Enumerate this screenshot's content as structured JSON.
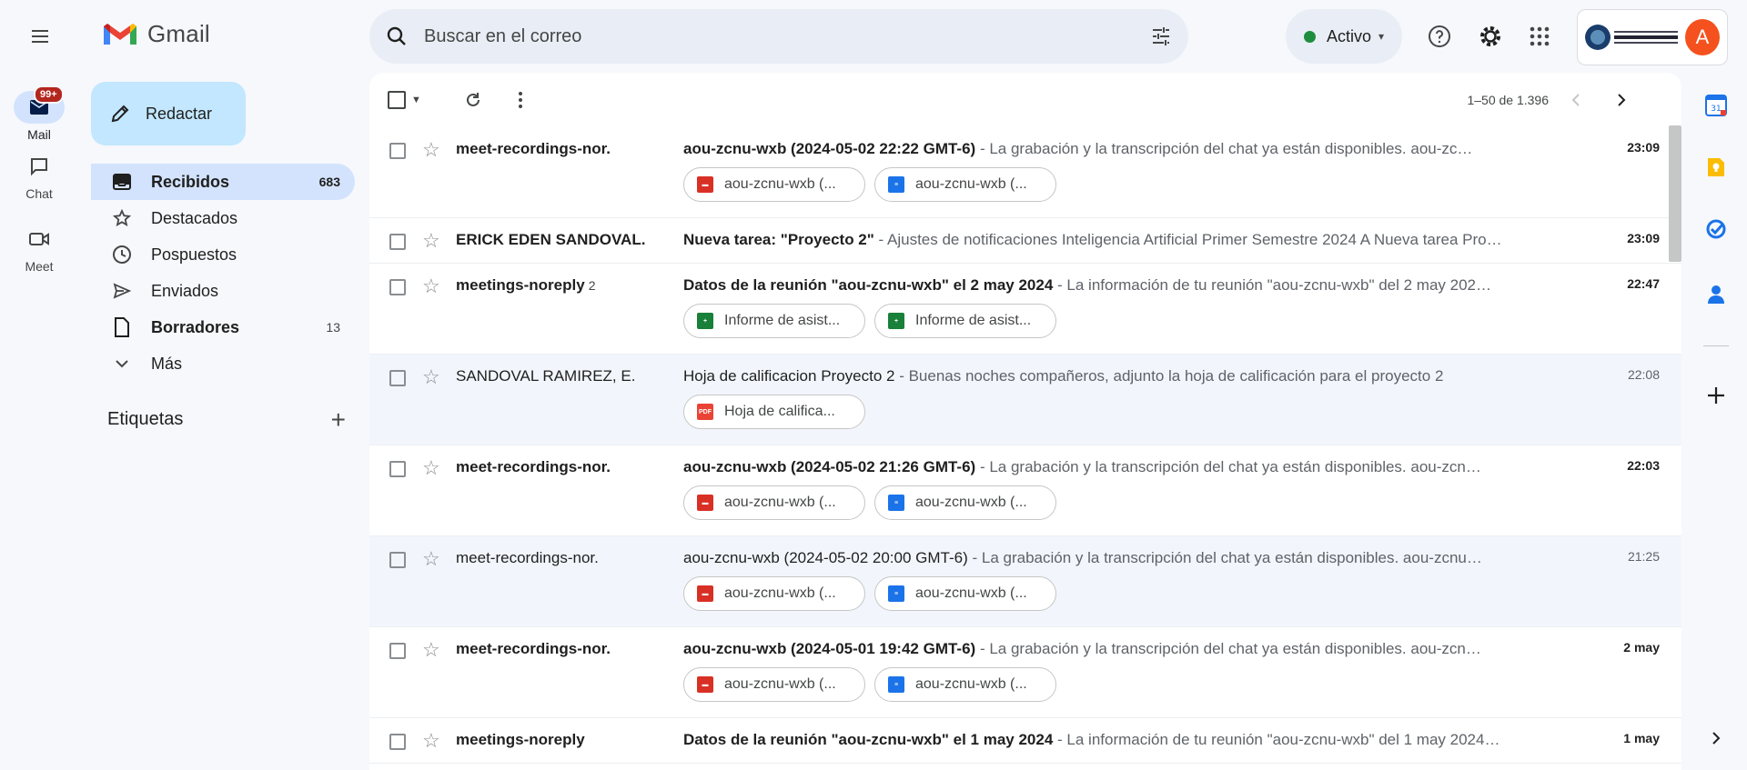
{
  "rail": {
    "items": [
      {
        "label": "Mail",
        "badge": "99+"
      },
      {
        "label": "Chat"
      },
      {
        "label": "Meet"
      }
    ]
  },
  "app": {
    "name": "Gmail"
  },
  "search": {
    "placeholder": "Buscar en el correo"
  },
  "status": {
    "label": "Activo"
  },
  "compose": {
    "label": "Redactar"
  },
  "nav": [
    {
      "label": "Recibidos",
      "count": "683",
      "icon": "inbox-icon"
    },
    {
      "label": "Destacados",
      "count": "",
      "icon": "star-icon"
    },
    {
      "label": "Pospuestos",
      "count": "",
      "icon": "clock-icon"
    },
    {
      "label": "Enviados",
      "count": "",
      "icon": "send-icon"
    },
    {
      "label": "Borradores",
      "count": "13",
      "icon": "draft-icon"
    },
    {
      "label": "Más",
      "count": "",
      "icon": "chevron-down-icon"
    }
  ],
  "labels": {
    "title": "Etiquetas"
  },
  "pager": {
    "text": "1–50 de 1.396"
  },
  "emails": [
    {
      "sender": "meet-recordings-nor.",
      "count": "",
      "subject": "aou-zcnu-wxb (2024-05-02 22:22 GMT-6)",
      "snippet": " - La grabación y la transcripción del chat ya están disponibles. aou-zc…",
      "date": "23:09",
      "unread": true,
      "attachments": [
        {
          "type": "video",
          "name": "aou-zcnu-wxb (..."
        },
        {
          "type": "doc",
          "name": "aou-zcnu-wxb (..."
        }
      ]
    },
    {
      "sender": "ERICK EDEN SANDOVAL.",
      "count": "",
      "subject": "Nueva tarea: \"Proyecto 2\"",
      "snippet": " - Ajustes de notificaciones Inteligencia Artificial Primer Semestre 2024 A Nueva tarea Pro…",
      "date": "23:09",
      "unread": true,
      "attachments": []
    },
    {
      "sender": "meetings-noreply",
      "count": "2",
      "subject": "Datos de la reunión \"aou-zcnu-wxb\" el 2 may 2024",
      "snippet": " - La información de tu reunión \"aou-zcnu-wxb\" del 2 may 202…",
      "date": "22:47",
      "unread": true,
      "attachments": [
        {
          "type": "sheet",
          "name": "Informe de asist..."
        },
        {
          "type": "sheet",
          "name": "Informe de asist..."
        }
      ]
    },
    {
      "sender": "SANDOVAL RAMIREZ, E.",
      "count": "",
      "subject": "Hoja de calificacion Proyecto 2",
      "snippet": " - Buenas noches compañeros, adjunto la hoja de calificación para el proyecto 2",
      "date": "22:08",
      "unread": false,
      "attachments": [
        {
          "type": "pdf",
          "name": "Hoja de califica..."
        }
      ]
    },
    {
      "sender": "meet-recordings-nor.",
      "count": "",
      "subject": "aou-zcnu-wxb (2024-05-02 21:26 GMT-6)",
      "snippet": " - La grabación y la transcripción del chat ya están disponibles. aou-zcn…",
      "date": "22:03",
      "unread": true,
      "attachments": [
        {
          "type": "video",
          "name": "aou-zcnu-wxb (..."
        },
        {
          "type": "doc",
          "name": "aou-zcnu-wxb (..."
        }
      ]
    },
    {
      "sender": "meet-recordings-nor.",
      "count": "",
      "subject": "aou-zcnu-wxb (2024-05-02 20:00 GMT-6)",
      "snippet": " - La grabación y la transcripción del chat ya están disponibles. aou-zcnu…",
      "date": "21:25",
      "unread": false,
      "attachments": [
        {
          "type": "video",
          "name": "aou-zcnu-wxb (..."
        },
        {
          "type": "doc",
          "name": "aou-zcnu-wxb (..."
        }
      ]
    },
    {
      "sender": "meet-recordings-nor.",
      "count": "",
      "subject": "aou-zcnu-wxb (2024-05-01 19:42 GMT-6)",
      "snippet": " - La grabación y la transcripción del chat ya están disponibles. aou-zcn…",
      "date": "2 may",
      "unread": true,
      "attachments": [
        {
          "type": "video",
          "name": "aou-zcnu-wxb (..."
        },
        {
          "type": "doc",
          "name": "aou-zcnu-wxb (..."
        }
      ]
    },
    {
      "sender": "meetings-noreply",
      "count": "",
      "subject": "Datos de la reunión \"aou-zcnu-wxb\" el 1 may 2024",
      "snippet": " - La información de tu reunión \"aou-zcnu-wxb\" del 1 may 2024…",
      "date": "1 may",
      "unread": true,
      "attachments": []
    }
  ],
  "account": {
    "avatar_letter": "A"
  },
  "colors": {
    "accent": "#0b57d0",
    "active_nav": "#d3e3fd",
    "compose": "#c2e7ff",
    "status_green": "#1e8e3e",
    "avatar": "#f4511e"
  },
  "side_panel": {
    "icons": [
      "calendar-icon",
      "keep-icon",
      "tasks-icon",
      "contacts-icon",
      "add-icon"
    ]
  }
}
